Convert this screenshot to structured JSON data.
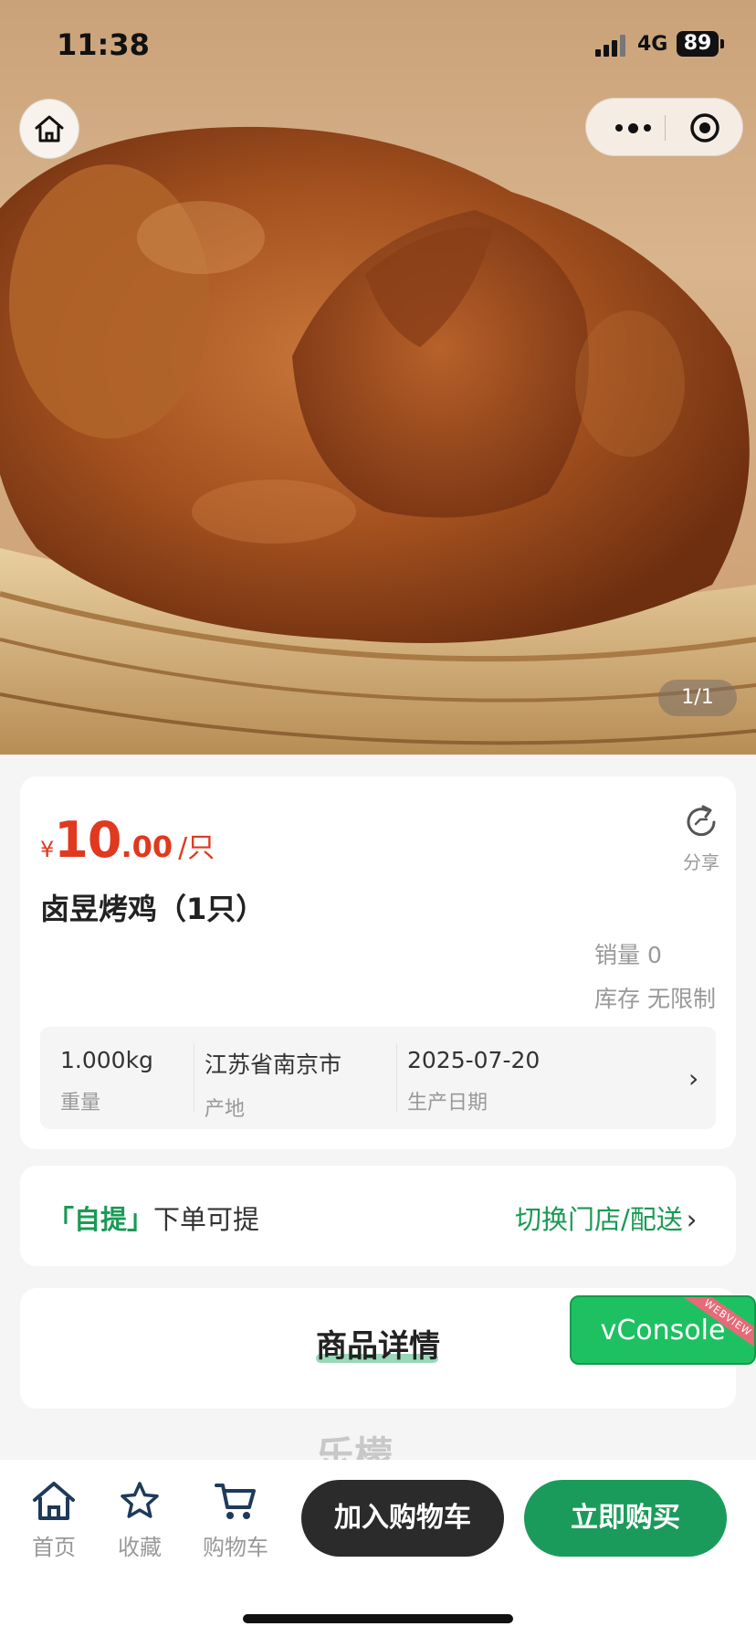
{
  "status_bar": {
    "time": "11:38",
    "network": "4G",
    "battery": "89"
  },
  "gallery": {
    "counter": "1/1"
  },
  "product": {
    "price_symbol": "¥",
    "price_integer": "10",
    "price_decimal": ".00",
    "price_unit": "/只",
    "share_label": "分享",
    "title": "卤昱烤鸡（1只）",
    "sales": "销量 0",
    "stock": "库存 无限制",
    "specs": [
      {
        "value": "1.000kg",
        "label": "重量"
      },
      {
        "value": "江苏省南京市",
        "label": "产地"
      },
      {
        "value": "2025-07-20",
        "label": "生产日期"
      }
    ]
  },
  "pickup": {
    "tag": "「自提」",
    "text": "下单可提",
    "switch_label": "切换门店/配送",
    "arrow": "›"
  },
  "detail": {
    "tab": "商品详情"
  },
  "vconsole": {
    "label": "vConsole",
    "ribbon": "WEBVIEW"
  },
  "watermark": "乐檬",
  "bottom_nav": {
    "home": "首页",
    "favorite": "收藏",
    "cart": "购物车",
    "add_to_cart": "加入购物车",
    "buy_now": "立即购买"
  },
  "colors": {
    "price": "#e0391f",
    "accent_green": "#1a9a55",
    "buy_button": "#1b9b5b",
    "cart_button": "#2b2b2b"
  }
}
